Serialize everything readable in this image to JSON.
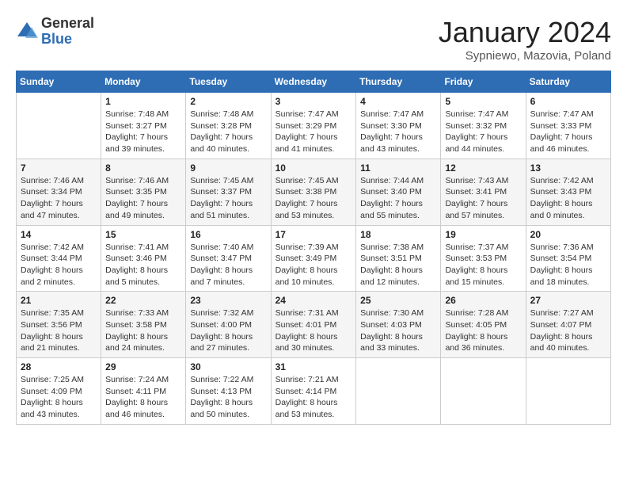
{
  "logo": {
    "general": "General",
    "blue": "Blue"
  },
  "header": {
    "month": "January 2024",
    "location": "Sypniewo, Mazovia, Poland"
  },
  "days_of_week": [
    "Sunday",
    "Monday",
    "Tuesday",
    "Wednesday",
    "Thursday",
    "Friday",
    "Saturday"
  ],
  "weeks": [
    [
      {
        "day": "",
        "info": ""
      },
      {
        "day": "1",
        "info": "Sunrise: 7:48 AM\nSunset: 3:27 PM\nDaylight: 7 hours\nand 39 minutes."
      },
      {
        "day": "2",
        "info": "Sunrise: 7:48 AM\nSunset: 3:28 PM\nDaylight: 7 hours\nand 40 minutes."
      },
      {
        "day": "3",
        "info": "Sunrise: 7:47 AM\nSunset: 3:29 PM\nDaylight: 7 hours\nand 41 minutes."
      },
      {
        "day": "4",
        "info": "Sunrise: 7:47 AM\nSunset: 3:30 PM\nDaylight: 7 hours\nand 43 minutes."
      },
      {
        "day": "5",
        "info": "Sunrise: 7:47 AM\nSunset: 3:32 PM\nDaylight: 7 hours\nand 44 minutes."
      },
      {
        "day": "6",
        "info": "Sunrise: 7:47 AM\nSunset: 3:33 PM\nDaylight: 7 hours\nand 46 minutes."
      }
    ],
    [
      {
        "day": "7",
        "info": "Sunrise: 7:46 AM\nSunset: 3:34 PM\nDaylight: 7 hours\nand 47 minutes."
      },
      {
        "day": "8",
        "info": "Sunrise: 7:46 AM\nSunset: 3:35 PM\nDaylight: 7 hours\nand 49 minutes."
      },
      {
        "day": "9",
        "info": "Sunrise: 7:45 AM\nSunset: 3:37 PM\nDaylight: 7 hours\nand 51 minutes."
      },
      {
        "day": "10",
        "info": "Sunrise: 7:45 AM\nSunset: 3:38 PM\nDaylight: 7 hours\nand 53 minutes."
      },
      {
        "day": "11",
        "info": "Sunrise: 7:44 AM\nSunset: 3:40 PM\nDaylight: 7 hours\nand 55 minutes."
      },
      {
        "day": "12",
        "info": "Sunrise: 7:43 AM\nSunset: 3:41 PM\nDaylight: 7 hours\nand 57 minutes."
      },
      {
        "day": "13",
        "info": "Sunrise: 7:42 AM\nSunset: 3:43 PM\nDaylight: 8 hours\nand 0 minutes."
      }
    ],
    [
      {
        "day": "14",
        "info": "Sunrise: 7:42 AM\nSunset: 3:44 PM\nDaylight: 8 hours\nand 2 minutes."
      },
      {
        "day": "15",
        "info": "Sunrise: 7:41 AM\nSunset: 3:46 PM\nDaylight: 8 hours\nand 5 minutes."
      },
      {
        "day": "16",
        "info": "Sunrise: 7:40 AM\nSunset: 3:47 PM\nDaylight: 8 hours\nand 7 minutes."
      },
      {
        "day": "17",
        "info": "Sunrise: 7:39 AM\nSunset: 3:49 PM\nDaylight: 8 hours\nand 10 minutes."
      },
      {
        "day": "18",
        "info": "Sunrise: 7:38 AM\nSunset: 3:51 PM\nDaylight: 8 hours\nand 12 minutes."
      },
      {
        "day": "19",
        "info": "Sunrise: 7:37 AM\nSunset: 3:53 PM\nDaylight: 8 hours\nand 15 minutes."
      },
      {
        "day": "20",
        "info": "Sunrise: 7:36 AM\nSunset: 3:54 PM\nDaylight: 8 hours\nand 18 minutes."
      }
    ],
    [
      {
        "day": "21",
        "info": "Sunrise: 7:35 AM\nSunset: 3:56 PM\nDaylight: 8 hours\nand 21 minutes."
      },
      {
        "day": "22",
        "info": "Sunrise: 7:33 AM\nSunset: 3:58 PM\nDaylight: 8 hours\nand 24 minutes."
      },
      {
        "day": "23",
        "info": "Sunrise: 7:32 AM\nSunset: 4:00 PM\nDaylight: 8 hours\nand 27 minutes."
      },
      {
        "day": "24",
        "info": "Sunrise: 7:31 AM\nSunset: 4:01 PM\nDaylight: 8 hours\nand 30 minutes."
      },
      {
        "day": "25",
        "info": "Sunrise: 7:30 AM\nSunset: 4:03 PM\nDaylight: 8 hours\nand 33 minutes."
      },
      {
        "day": "26",
        "info": "Sunrise: 7:28 AM\nSunset: 4:05 PM\nDaylight: 8 hours\nand 36 minutes."
      },
      {
        "day": "27",
        "info": "Sunrise: 7:27 AM\nSunset: 4:07 PM\nDaylight: 8 hours\nand 40 minutes."
      }
    ],
    [
      {
        "day": "28",
        "info": "Sunrise: 7:25 AM\nSunset: 4:09 PM\nDaylight: 8 hours\nand 43 minutes."
      },
      {
        "day": "29",
        "info": "Sunrise: 7:24 AM\nSunset: 4:11 PM\nDaylight: 8 hours\nand 46 minutes."
      },
      {
        "day": "30",
        "info": "Sunrise: 7:22 AM\nSunset: 4:13 PM\nDaylight: 8 hours\nand 50 minutes."
      },
      {
        "day": "31",
        "info": "Sunrise: 7:21 AM\nSunset: 4:14 PM\nDaylight: 8 hours\nand 53 minutes."
      },
      {
        "day": "",
        "info": ""
      },
      {
        "day": "",
        "info": ""
      },
      {
        "day": "",
        "info": ""
      }
    ]
  ]
}
